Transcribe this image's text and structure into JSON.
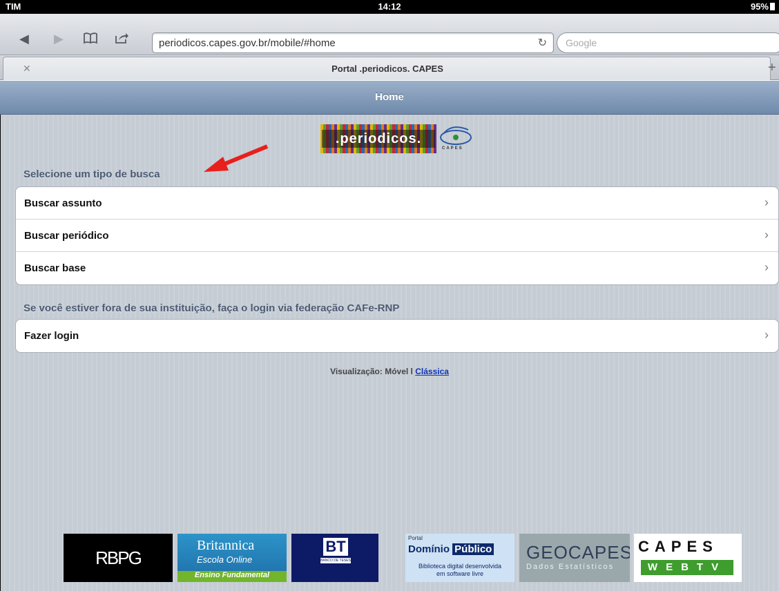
{
  "status_bar": {
    "carrier": "TIM",
    "time": "14:12",
    "battery": "95%"
  },
  "browser": {
    "url": "periodicos.capes.gov.br/mobile/#home",
    "search_placeholder": "Google",
    "tab_title": "Portal .periodicos. CAPES"
  },
  "header": {
    "title": "Home"
  },
  "logo": {
    "brand": ".periodicos.",
    "org": "CAPES"
  },
  "search_section": {
    "label": "Selecione um tipo de busca",
    "items": [
      {
        "label": "Buscar assunto"
      },
      {
        "label": "Buscar periódico"
      },
      {
        "label": "Buscar base"
      }
    ]
  },
  "login_section": {
    "label": "Se você estiver fora de sua instituição, faça o login via federação CAFe-RNP",
    "items": [
      {
        "label": "Fazer login"
      }
    ]
  },
  "view": {
    "prefix": "Visualização: Móvel l",
    "classic_link": "Clássica"
  },
  "banners": {
    "rbpg": "RBPG",
    "britannica": {
      "title": "Britannica",
      "subtitle": "Escola Online",
      "tagline": "Ensino Fundamental"
    },
    "bt": {
      "short": "BT",
      "caption": "BANCO DE TESES"
    },
    "dominio": {
      "portal": "Portal",
      "name1": "Domínio",
      "name2": "Público",
      "desc1": "Biblioteca digital desenvolvida",
      "desc2": "em software livre"
    },
    "geocapes": {
      "title": "GEOCAPES",
      "subtitle": "Dados Estatísticos"
    },
    "capes_tv": {
      "top": "CAPES",
      "bottom": "WEBTV"
    }
  },
  "colors": {
    "arrow": "#e8201c",
    "header": "#7b94b3",
    "link": "#1034b8"
  }
}
